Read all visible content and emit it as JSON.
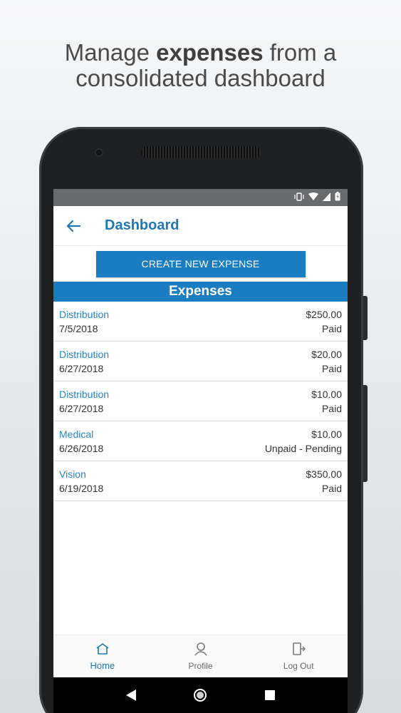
{
  "headline": {
    "before": "Manage ",
    "bold": "expenses",
    "after": " from a",
    "line2": "consolidated dashboard"
  },
  "status_bar": {
    "icons": [
      "vibrate-icon",
      "wifi-icon",
      "signal-icon",
      "battery-icon"
    ]
  },
  "app_bar": {
    "back_icon": "back-arrow-icon",
    "title": "Dashboard"
  },
  "create_button": {
    "label": "CREATE NEW EXPENSE"
  },
  "expenses": {
    "heading": "Expenses",
    "items": [
      {
        "category": "Distribution",
        "date": "7/5/2018",
        "amount": "$250.00",
        "status": "Paid"
      },
      {
        "category": "Distribution",
        "date": "6/27/2018",
        "amount": "$20.00",
        "status": "Paid"
      },
      {
        "category": "Distribution",
        "date": "6/27/2018",
        "amount": "$10.00",
        "status": "Paid"
      },
      {
        "category": "Medical",
        "date": "6/26/2018",
        "amount": "$10.00",
        "status": "Unpaid - Pending"
      },
      {
        "category": "Vision",
        "date": "6/19/2018",
        "amount": "$350.00",
        "status": "Paid"
      }
    ]
  },
  "bottom_nav": {
    "items": [
      {
        "label": "Home",
        "icon": "home-icon",
        "active": true
      },
      {
        "label": "Profile",
        "icon": "profile-icon",
        "active": false
      },
      {
        "label": "Log Out",
        "icon": "logout-icon",
        "active": false
      }
    ]
  },
  "system_nav": {
    "icons": [
      "system-back-icon",
      "system-home-icon",
      "system-recents-icon"
    ]
  },
  "colors": {
    "accent": "#1a7cc1",
    "title": "#1f78b4",
    "category_text": "#2a86c3"
  }
}
